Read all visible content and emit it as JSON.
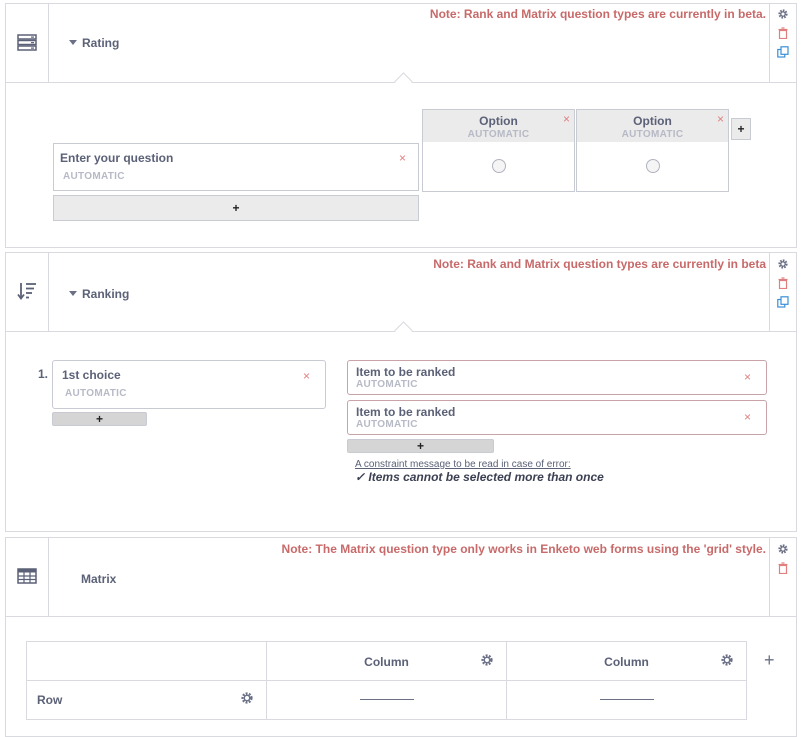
{
  "rating": {
    "note": "Note: Rank and Matrix question types are currently in beta.",
    "label": "Rating",
    "options": [
      {
        "label": "Option",
        "auto": "AUTOMATIC"
      },
      {
        "label": "Option",
        "auto": "AUTOMATIC"
      }
    ],
    "question": {
      "label": "Enter your question",
      "auto": "AUTOMATIC"
    },
    "close": "×",
    "plus": "+"
  },
  "ranking": {
    "note": "Note: Rank and Matrix question types are currently in beta",
    "label": "Ranking",
    "choice_number": "1.",
    "choice": {
      "label": "1st choice",
      "auto": "AUTOMATIC"
    },
    "items": [
      {
        "label": "Item to be ranked",
        "auto": "AUTOMATIC"
      },
      {
        "label": "Item to be ranked",
        "auto": "AUTOMATIC"
      }
    ],
    "constraint_label": "A constraint message to be read in case of error:",
    "constraint_text": "✓ Items cannot be selected more than once",
    "close": "×",
    "plus": "+"
  },
  "matrix": {
    "note": "Note: The Matrix question type only works in Enketo web forms using the 'grid' style.",
    "label": "Matrix",
    "columns": [
      "Column",
      "Column"
    ],
    "row": "Row",
    "plus": "+"
  },
  "icons": {
    "rating": "list-rows-icon",
    "ranking": "sort-descending-icon",
    "matrix": "table-grid-icon",
    "settings": "gear-icon",
    "delete": "trash-icon",
    "duplicate": "duplicate-icon"
  },
  "colors": {
    "note": "#c86a6a",
    "delete": "#e07f7f",
    "duplicate": "#3a8fd6",
    "border": "#d9dadf"
  }
}
